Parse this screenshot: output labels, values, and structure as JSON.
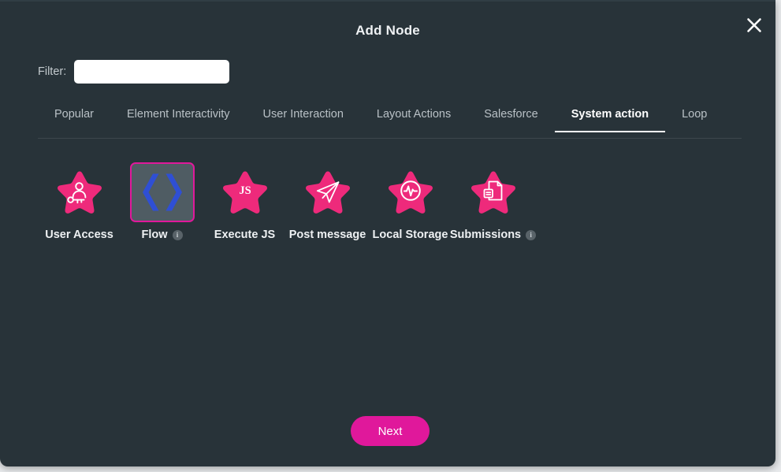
{
  "modal": {
    "title": "Add Node",
    "close_icon": "close-icon",
    "accent_color": "#e0189b",
    "background_color": "#283339",
    "page_background": "#e8eaec"
  },
  "filter": {
    "label": "Filter:",
    "value": "",
    "placeholder": ""
  },
  "tabs": [
    {
      "label": "Popular",
      "active": false
    },
    {
      "label": "Element Interactivity",
      "active": false
    },
    {
      "label": "User Interaction",
      "active": false
    },
    {
      "label": "Layout Actions",
      "active": false
    },
    {
      "label": "Salesforce",
      "active": false
    },
    {
      "label": "System action",
      "active": true
    },
    {
      "label": "Loop",
      "active": false
    }
  ],
  "nodes": [
    {
      "label": "User Access",
      "icon": "user-key-star-icon",
      "selected": false,
      "has_info": false,
      "info_label": ""
    },
    {
      "label": "Flow",
      "icon": "angle-brackets-icon",
      "selected": true,
      "has_info": true,
      "info_label": "i"
    },
    {
      "label": "Execute JS",
      "icon": "js-star-icon",
      "selected": false,
      "has_info": false,
      "info_label": ""
    },
    {
      "label": "Post message",
      "icon": "paper-plane-star-icon",
      "selected": false,
      "has_info": false,
      "info_label": ""
    },
    {
      "label": "Local Storage",
      "icon": "pulse-circle-star-icon",
      "selected": false,
      "has_info": false,
      "info_label": ""
    },
    {
      "label": "Submissions",
      "icon": "documents-star-icon",
      "selected": false,
      "has_info": true,
      "info_label": "i"
    }
  ],
  "footer": {
    "next_label": "Next"
  }
}
